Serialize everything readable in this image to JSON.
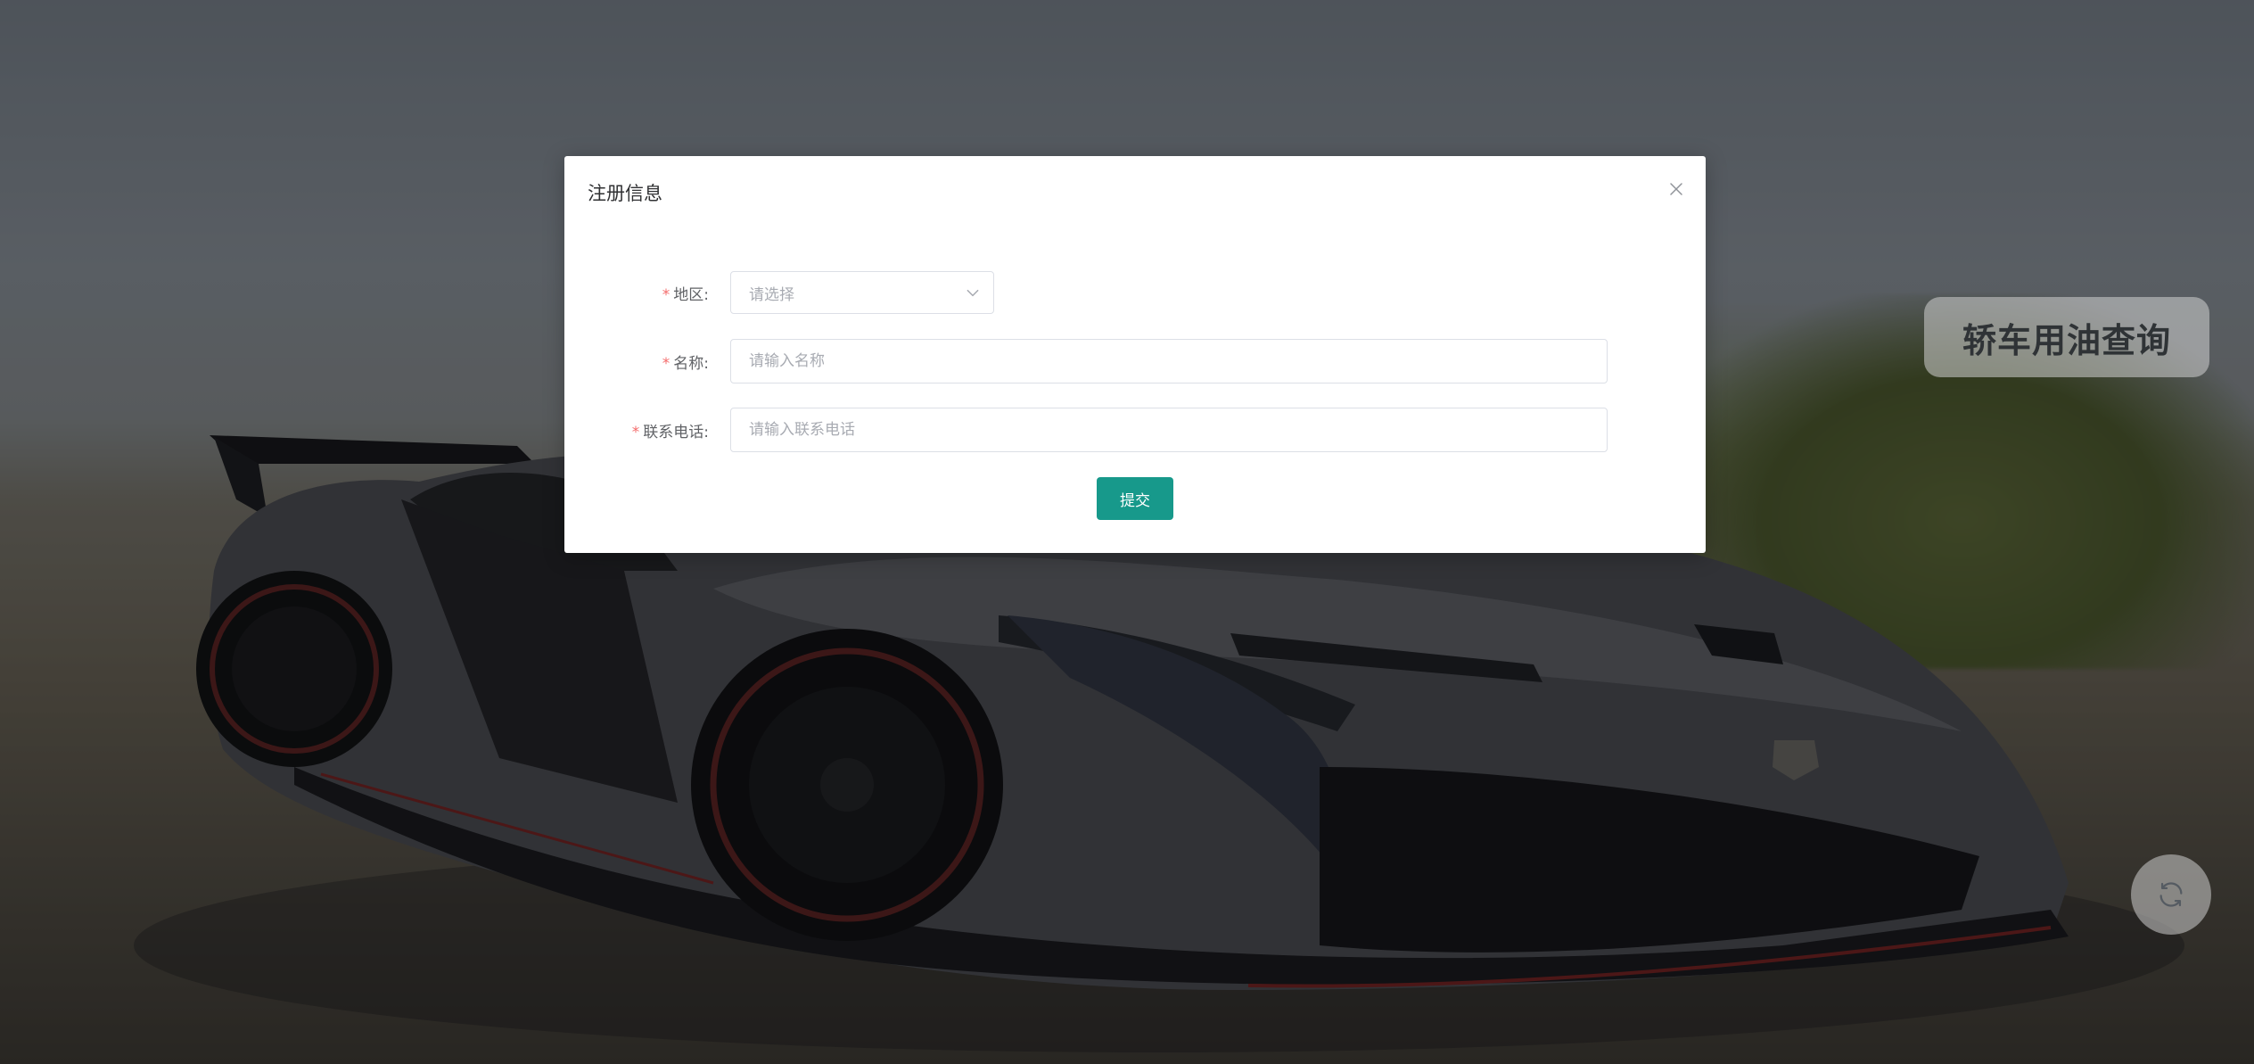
{
  "dialog": {
    "title": "注册信息",
    "fields": {
      "region": {
        "label": "地区:",
        "required_mark": "*",
        "placeholder": "请选择",
        "value": ""
      },
      "name": {
        "label": "名称:",
        "required_mark": "*",
        "placeholder": "请输入名称",
        "value": ""
      },
      "phone": {
        "label": "联系电话:",
        "required_mark": "*",
        "placeholder": "请输入联系电话",
        "value": ""
      }
    },
    "submit_label": "提交"
  },
  "side_widget": {
    "label": "轿车用油查询"
  },
  "icons": {
    "close": "close-icon",
    "chevron": "chevron-down-icon",
    "refresh": "refresh-icon"
  },
  "colors": {
    "primary": "#17998b",
    "required": "#f56c6c"
  }
}
